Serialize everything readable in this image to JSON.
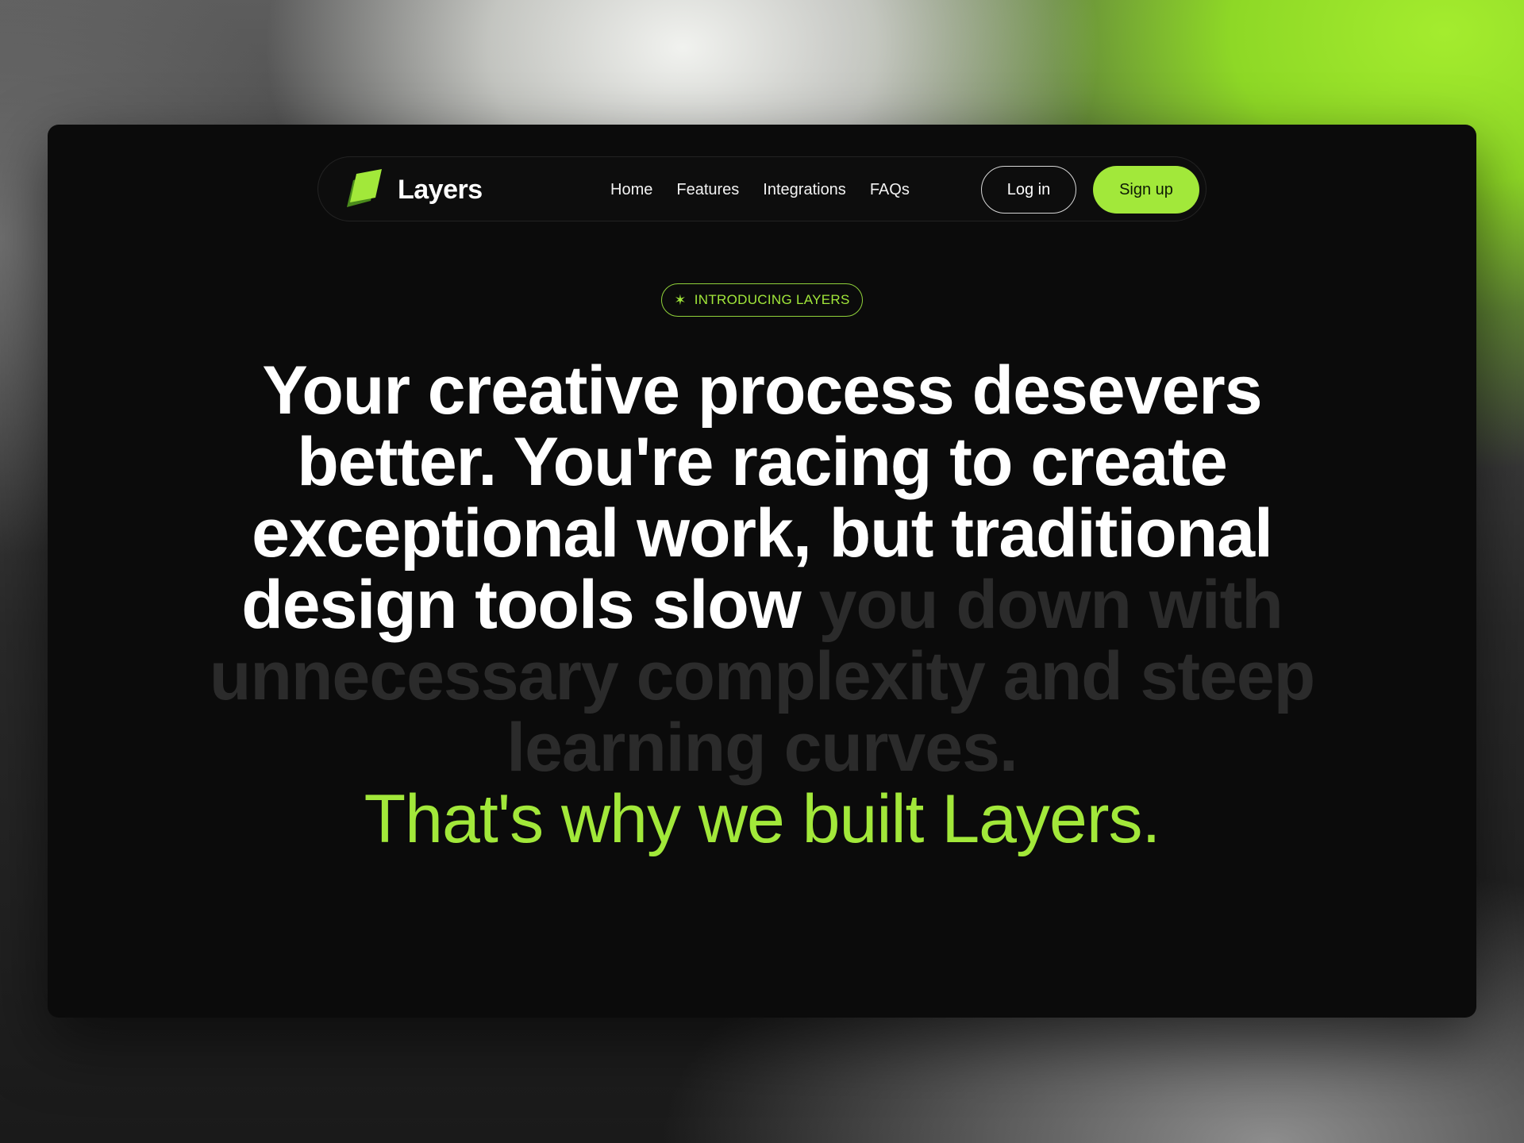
{
  "brand": {
    "name": "Layers",
    "logo_icon": "layers-logo-icon"
  },
  "nav": {
    "items": [
      {
        "label": "Home"
      },
      {
        "label": "Features"
      },
      {
        "label": "Integrations"
      },
      {
        "label": "FAQs"
      }
    ],
    "login_label": "Log in",
    "signup_label": "Sign up"
  },
  "hero": {
    "badge": {
      "icon": "sparkle-icon",
      "label": "INTRODUCING LAYERS"
    },
    "headline_bright": "Your creative process desevers better. You're racing to create exceptional work, but traditional design tools slow",
    "headline_dim": "you down with unnecessary complexity and steep learning curves.",
    "tagline": "That's why we built Layers."
  },
  "colors": {
    "accent": "#a2e83a",
    "background": "#0b0b0b",
    "text": "#ffffff",
    "dim_text": "#2b2b2b"
  }
}
